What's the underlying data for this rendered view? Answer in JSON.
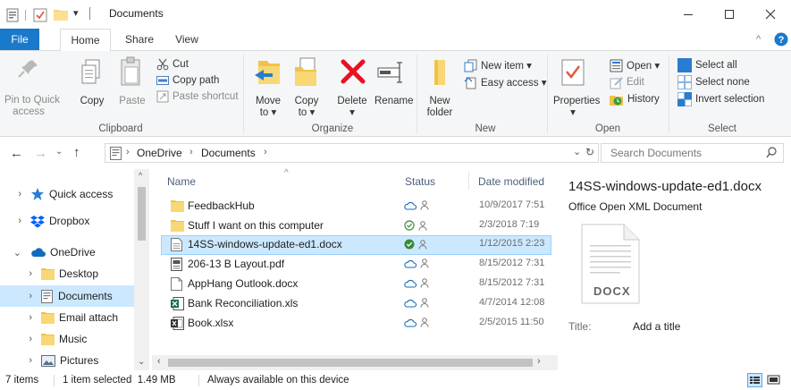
{
  "window": {
    "title": "Documents",
    "controls": [
      "minimize-icon",
      "maximize-icon",
      "close-icon"
    ]
  },
  "ribbon_tabs": [
    {
      "label": "File"
    },
    {
      "label": "Home"
    },
    {
      "label": "Share"
    },
    {
      "label": "View"
    }
  ],
  "ribbon": {
    "clipboard": {
      "label": "Clipboard",
      "pin_line1": "Pin to Quick",
      "pin_line2": "access",
      "copy": "Copy",
      "paste": "Paste",
      "cut": "Cut",
      "copy_path": "Copy path",
      "paste_shortcut": "Paste shortcut"
    },
    "organize": {
      "label": "Organize",
      "move_to_line1": "Move",
      "move_to_line2": "to ▾",
      "copy_to_line1": "Copy",
      "copy_to_line2": "to ▾",
      "delete": "Delete",
      "delete_arrow": "▾",
      "rename": "Rename"
    },
    "new": {
      "label": "New",
      "new_folder_line1": "New",
      "new_folder_line2": "folder",
      "new_item": "New item ▾",
      "easy_access": "Easy access ▾"
    },
    "open": {
      "label": "Open",
      "properties": "Properties",
      "properties_arrow": "▾",
      "open": "Open ▾",
      "edit": "Edit",
      "history": "History"
    },
    "select": {
      "label": "Select",
      "select_all": "Select all",
      "select_none": "Select none",
      "invert_selection": "Invert selection"
    }
  },
  "address": {
    "crumbs": [
      "OneDrive",
      "Documents"
    ],
    "search_placeholder": "Search Documents"
  },
  "nav": [
    {
      "label": "Quick access",
      "icon": "star-icon",
      "expanded": false
    },
    {
      "label": "Dropbox",
      "icon": "dropbox-icon",
      "expanded": false
    },
    {
      "label": "OneDrive",
      "icon": "cloud-icon",
      "expanded": true
    },
    {
      "label": "Desktop",
      "icon": "folder-icon",
      "expanded": false
    },
    {
      "label": "Documents",
      "icon": "documents-icon",
      "expanded": false,
      "selected": true
    },
    {
      "label": "Email attach",
      "icon": "folder-icon",
      "expanded": false
    },
    {
      "label": "Music",
      "icon": "folder-icon",
      "expanded": false
    },
    {
      "label": "Pictures",
      "icon": "pictures-icon",
      "expanded": false
    }
  ],
  "columns": {
    "name": "Name",
    "status": "Status",
    "date": "Date modified"
  },
  "files": [
    {
      "name": "FeedbackHub",
      "type": "folder",
      "status": "cloud",
      "date": "10/9/2017 7:51"
    },
    {
      "name": "Stuff I want on this computer",
      "type": "folder",
      "status": "check",
      "date": "2/3/2018 7:19"
    },
    {
      "name": "14SS-windows-update-ed1.docx",
      "type": "docx",
      "status": "check-filled",
      "date": "1/12/2015 2:23",
      "selected": true
    },
    {
      "name": "206-13 B Layout.pdf",
      "type": "pdf",
      "status": "cloud",
      "date": "8/15/2012 7:31"
    },
    {
      "name": "AppHang Outlook.docx",
      "type": "doc",
      "status": "cloud",
      "date": "8/15/2012 7:31"
    },
    {
      "name": "Bank Reconciliation.xls",
      "type": "xls",
      "status": "cloud",
      "date": "4/7/2014 12:08"
    },
    {
      "name": "Book.xlsx",
      "type": "xlsx",
      "status": "cloud",
      "date": "2/5/2015 11:50"
    }
  ],
  "details": {
    "file_name": "14SS-windows-update-ed1.docx",
    "file_type": "Office Open XML Document",
    "thumb_label": "DOCX",
    "title_label": "Title:",
    "title_value": "Add a title"
  },
  "statusbar": {
    "items": "7 items",
    "selected": "1 item selected  1.49 MB",
    "availability": "Always available on this device"
  },
  "colors": {
    "accent": "#1979ca",
    "selection": "#cce8ff",
    "ribbon_bg": "#f5f6f7"
  }
}
